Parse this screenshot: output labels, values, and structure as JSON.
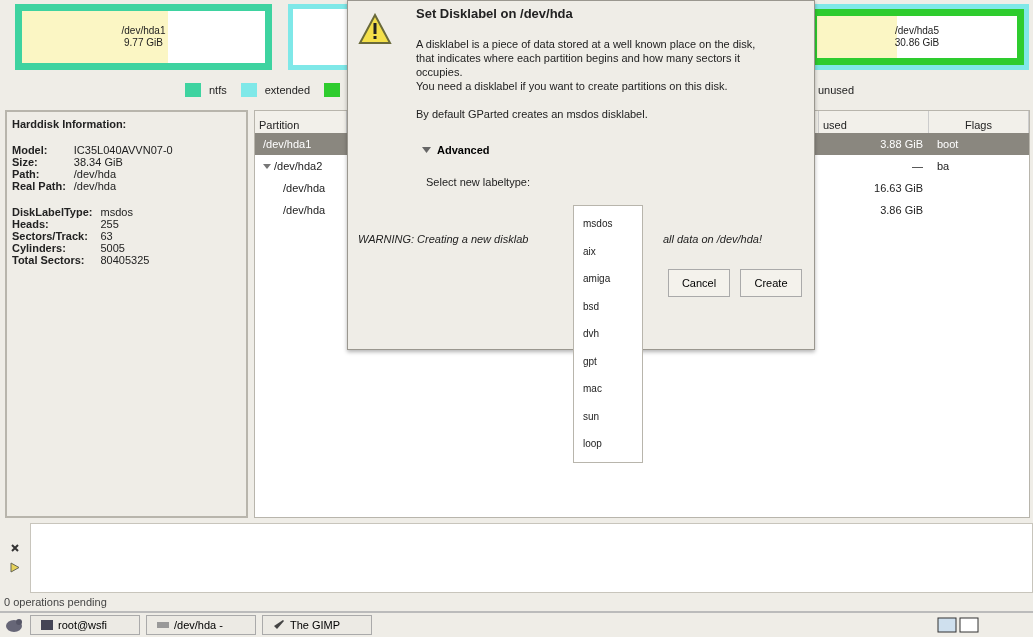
{
  "disk_map": [
    {
      "kind": "primary",
      "label": "/dev/hda1",
      "size": "9.77 GiB",
      "color": "#3ed3a0",
      "level": 0.6
    },
    {
      "kind": "extended",
      "color": "#7fe8e8",
      "children": [
        {
          "label": "/dev/hda5",
          "size": "30.86 GiB",
          "color": "#2ecc2e",
          "level": 0.4
        }
      ]
    }
  ],
  "legend": [
    {
      "label": "ntfs",
      "color": "#3ed3a0"
    },
    {
      "label": "extended",
      "color": "#7fe8e8"
    },
    {
      "color": "#2ecc2e"
    },
    {
      "label": "unused"
    }
  ],
  "disk_info": {
    "title": "Harddisk Information:",
    "groups": [
      [
        {
          "label": "Model:",
          "value": "IC35L040AVVN07-0"
        },
        {
          "label": "Size:",
          "value": "38.34 GiB"
        },
        {
          "label": "Path:",
          "value": "/dev/hda"
        },
        {
          "label": "Real Path:",
          "value": "/dev/hda"
        }
      ],
      [
        {
          "label": "DiskLabelType:",
          "value": "msdos"
        },
        {
          "label": "Heads:",
          "value": "255"
        },
        {
          "label": "Sectors/Track:",
          "value": "63"
        },
        {
          "label": "Cylinders:",
          "value": "5005"
        },
        {
          "label": "Total Sectors:",
          "value": "80405325"
        }
      ]
    ]
  },
  "table": {
    "columns": [
      "Partition",
      "used",
      "Flags"
    ],
    "rows": [
      {
        "partition": "/dev/hda1",
        "used": "3.88 GiB",
        "flags": "boot",
        "selected": true,
        "expander": false,
        "indent": false
      },
      {
        "partition": "/dev/hda2",
        "used": "—",
        "flags": "ba",
        "selected": false,
        "expander": true,
        "indent": false
      },
      {
        "partition": "/dev/hda",
        "used": "16.63 GiB",
        "selected": false,
        "expander": false,
        "indent": true
      },
      {
        "partition": "/dev/hda",
        "used": "3.86 GiB",
        "selected": false,
        "expander": false,
        "indent": true
      }
    ]
  },
  "dialog": {
    "title": "Set Disklabel on /dev/hda",
    "paragraph_1": "A disklabel is a piece of data stored at a well known place on the disk, that indicates where each partition begins and how many sectors it occupies.",
    "paragraph_2": "You need a disklabel if you want to create partitions on this disk.",
    "paragraph_3": "By default GParted creates an msdos disklabel.",
    "advanced": {
      "label": "Advanced",
      "expanded": true
    },
    "labeltype_label": "Select new labeltype:",
    "warning_start": "WARNING: Creating a new disklab",
    "warning_end": "all data on /dev/hda!",
    "buttons": [
      "Cancel",
      "Create"
    ]
  },
  "labeltype_menu": [
    "msdos",
    "aix",
    "amiga",
    "bsd",
    "dvh",
    "gpt",
    "mac",
    "sun",
    "loop"
  ],
  "status_bar": "0 operations pending",
  "taskbar": [
    {
      "label": "root@wsfi",
      "kind": "terminal"
    },
    {
      "label": "/dev/hda -",
      "kind": "gparted"
    },
    {
      "label": "The GIMP",
      "kind": "gimp"
    }
  ]
}
